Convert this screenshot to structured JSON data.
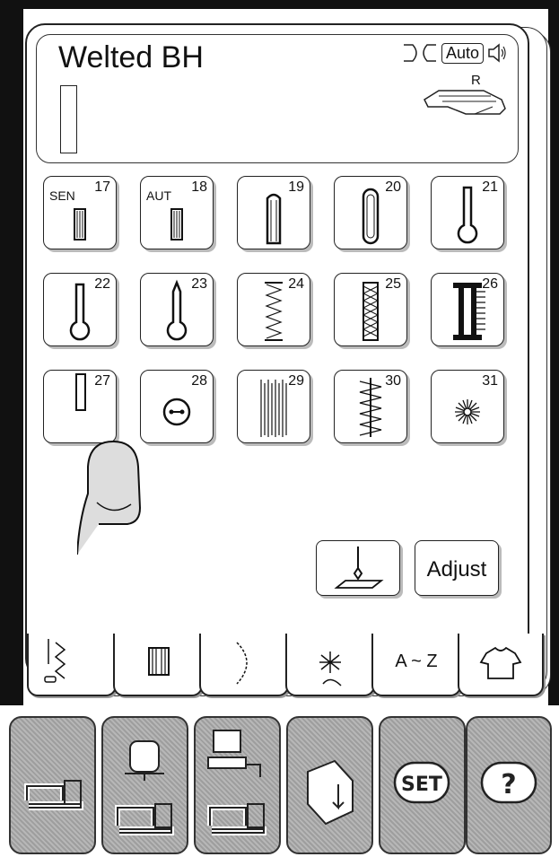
{
  "pattern_name": "Welted BH",
  "status": {
    "auto_label": "Auto",
    "foot_letter": "R"
  },
  "stitch_grid": [
    {
      "num": "17",
      "prefix": "SEN",
      "glyph": "buttonhole-small"
    },
    {
      "num": "18",
      "prefix": "AUT",
      "glyph": "buttonhole-small"
    },
    {
      "num": "19",
      "prefix": "",
      "glyph": "buttonhole-round-top"
    },
    {
      "num": "20",
      "prefix": "",
      "glyph": "buttonhole-round-both"
    },
    {
      "num": "21",
      "prefix": "",
      "glyph": "keyhole-buttonhole"
    },
    {
      "num": "22",
      "prefix": "",
      "glyph": "keyhole-buttonhole"
    },
    {
      "num": "23",
      "prefix": "",
      "glyph": "keyhole-tapered"
    },
    {
      "num": "24",
      "prefix": "",
      "glyph": "stretch-buttonhole"
    },
    {
      "num": "25",
      "prefix": "",
      "glyph": "heirloom-buttonhole"
    },
    {
      "num": "26",
      "prefix": "",
      "glyph": "fagoting-buttonhole"
    },
    {
      "num": "27",
      "prefix": "",
      "glyph": "welted-buttonhole"
    },
    {
      "num": "28",
      "prefix": "",
      "glyph": "button-sew-on"
    },
    {
      "num": "29",
      "prefix": "",
      "glyph": "darning"
    },
    {
      "num": "30",
      "prefix": "",
      "glyph": "bar-tack"
    },
    {
      "num": "31",
      "prefix": "",
      "glyph": "eyelet"
    }
  ],
  "function_buttons": {
    "adjust_label": "Adjust"
  },
  "tabs": [
    {
      "label": "",
      "icon": "utility-stitch-icon"
    },
    {
      "label": "",
      "icon": "buttonhole-icon"
    },
    {
      "label": "",
      "icon": "decorative-stitch-icon"
    },
    {
      "label": "",
      "icon": "quilt-stitch-icon"
    },
    {
      "label": "A ~ Z",
      "icon": "alphabet-icon"
    },
    {
      "label": "",
      "icon": "garment-icon"
    }
  ],
  "bottom_buttons": [
    {
      "icon": "sewing-machine-icon"
    },
    {
      "icon": "embroidery-machine-icon"
    },
    {
      "icon": "computer-to-machine-icon"
    },
    {
      "icon": "open-file-icon"
    },
    {
      "label": "SET",
      "icon": "set-icon"
    },
    {
      "label": "?",
      "icon": "help-icon"
    }
  ]
}
